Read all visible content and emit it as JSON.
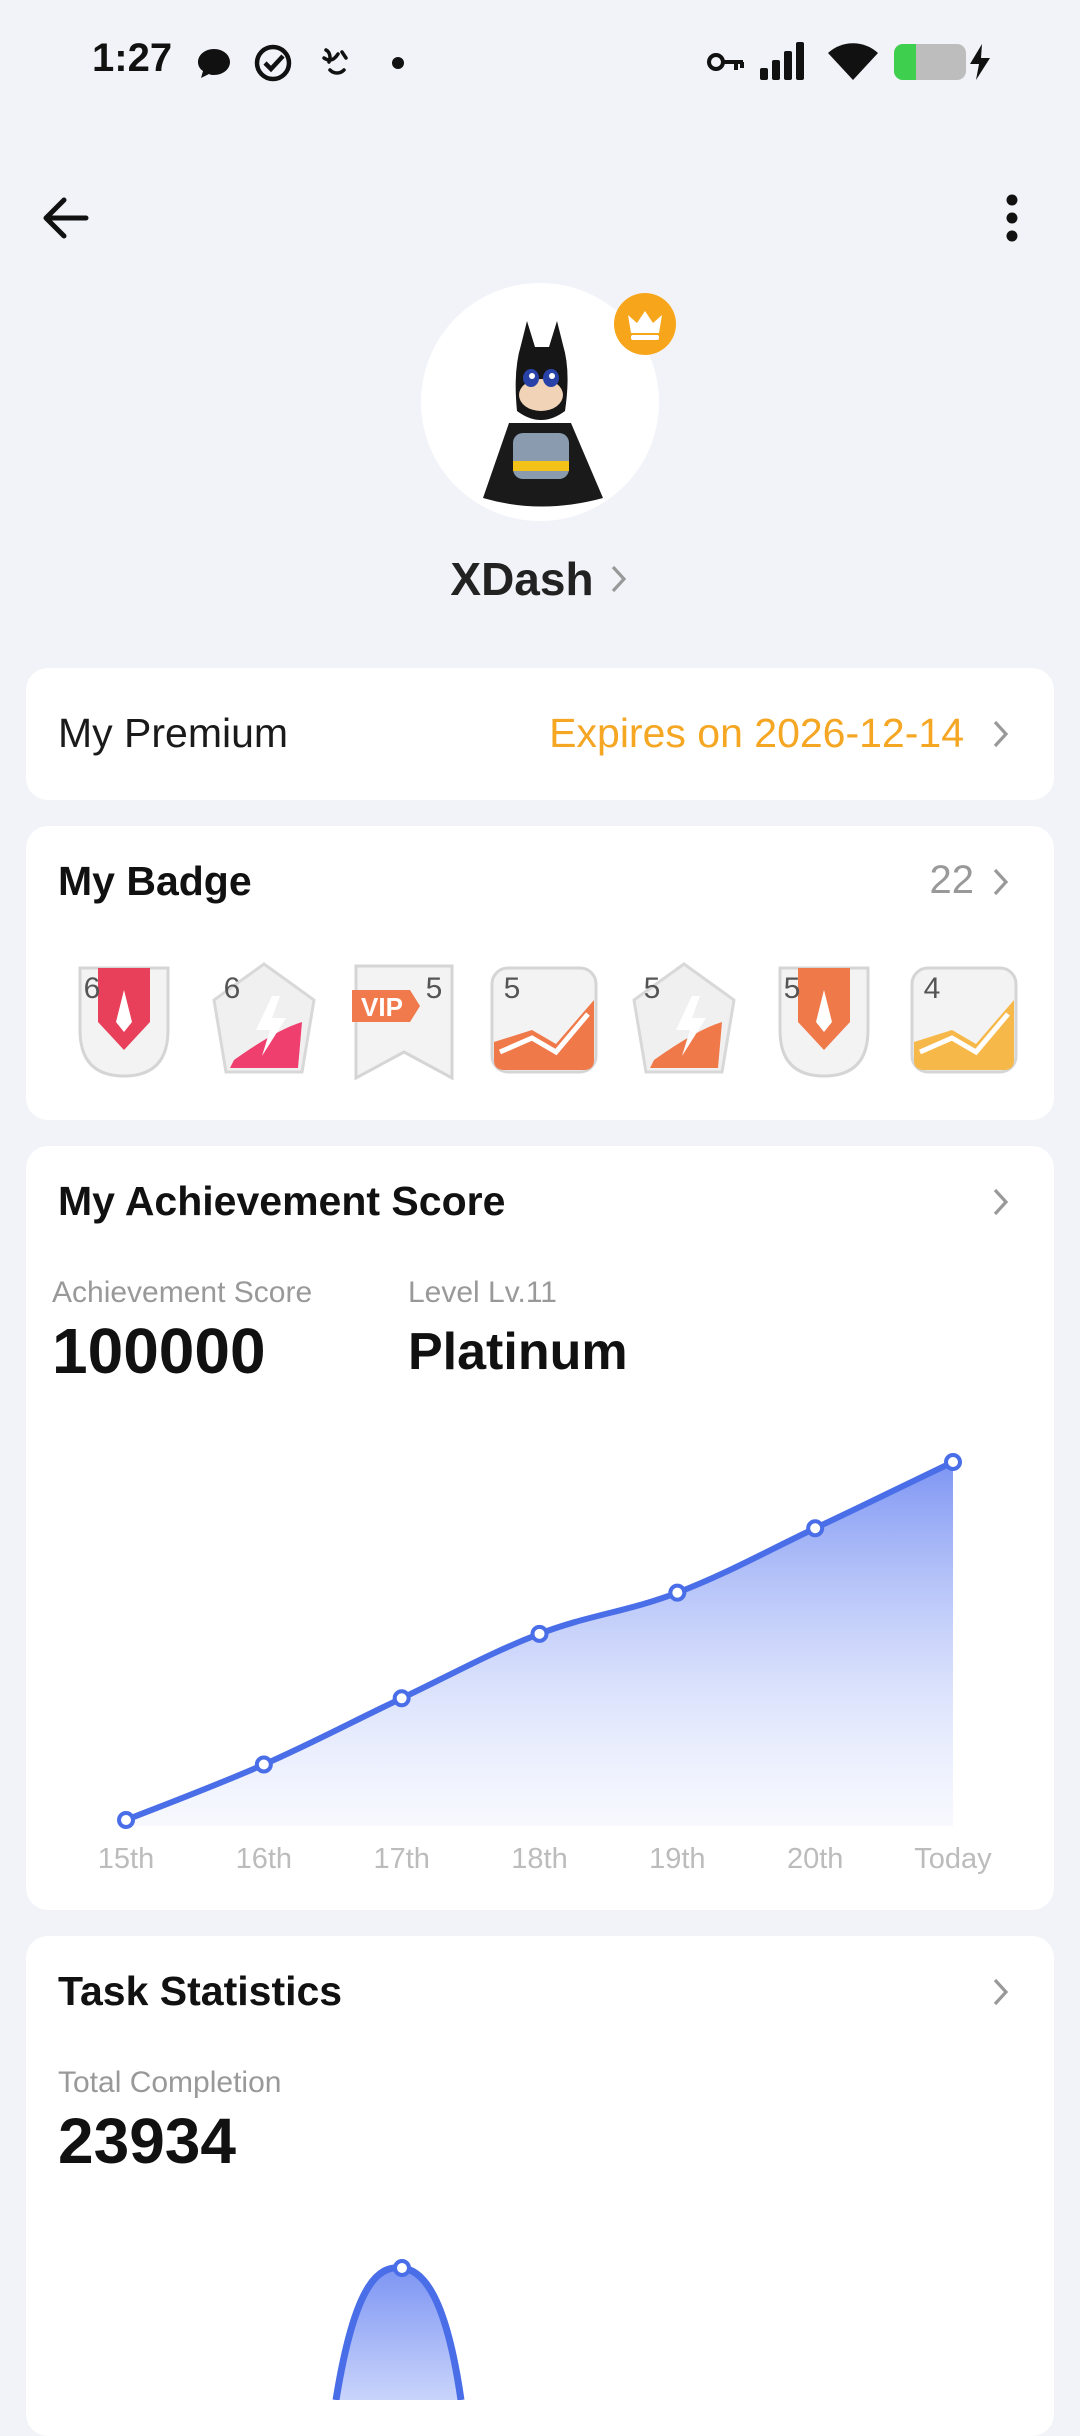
{
  "status_bar": {
    "time": "1:27",
    "left_icons": [
      "chat-bubble-icon",
      "check-circle-icon",
      "hand-gesture-icon",
      "dot-icon"
    ],
    "right_icons": [
      "key-icon",
      "signal-icon",
      "wifi-icon",
      "battery-charging-icon"
    ],
    "battery_level": 0.3
  },
  "header": {
    "back_icon": "arrow-left-icon",
    "more_icon": "vertical-dots-icon"
  },
  "profile": {
    "username": "XDash",
    "crown_icon": "crown-icon",
    "accent": "#f7a51a"
  },
  "premium": {
    "label": "My Premium",
    "value": "Expires on 2026-12-14",
    "value_color": "#f5a623"
  },
  "badges": {
    "title": "My Badge",
    "count": "22",
    "items": [
      {
        "icon": "rocket-badge-icon",
        "level": "6",
        "color": "#e8405a"
      },
      {
        "icon": "lightning-badge-icon",
        "level": "6",
        "color": "#ee3f6e"
      },
      {
        "icon": "vip-badge-icon",
        "level": "5",
        "label": "VIP",
        "color": "#f07a4b"
      },
      {
        "icon": "chart-badge-icon",
        "level": "5",
        "color": "#f0794a"
      },
      {
        "icon": "lightning-badge-icon",
        "level": "5",
        "color": "#f0794a"
      },
      {
        "icon": "rocket-badge-icon",
        "level": "5",
        "color": "#f0794a"
      },
      {
        "icon": "chart-badge-icon",
        "level": "4",
        "color": "#f7b84a"
      }
    ]
  },
  "achievement": {
    "title": "My Achievement Score",
    "score_label": "Achievement Score",
    "score": "100000",
    "level_label": "Level Lv.11",
    "level_name": "Platinum"
  },
  "tasks": {
    "title": "Task Statistics",
    "total_label": "Total Completion",
    "total": "23934"
  },
  "chart_data": [
    {
      "type": "area",
      "categories": [
        "15th",
        "16th",
        "17th",
        "18th",
        "19th",
        "20th",
        "Today"
      ],
      "values": [
        0,
        0.155,
        0.34,
        0.52,
        0.635,
        0.815,
        1.0
      ],
      "title": "",
      "xlabel": "",
      "ylabel": "",
      "ylim": [
        0,
        1
      ],
      "grid": false,
      "line_color": "#4a6ee8"
    }
  ]
}
